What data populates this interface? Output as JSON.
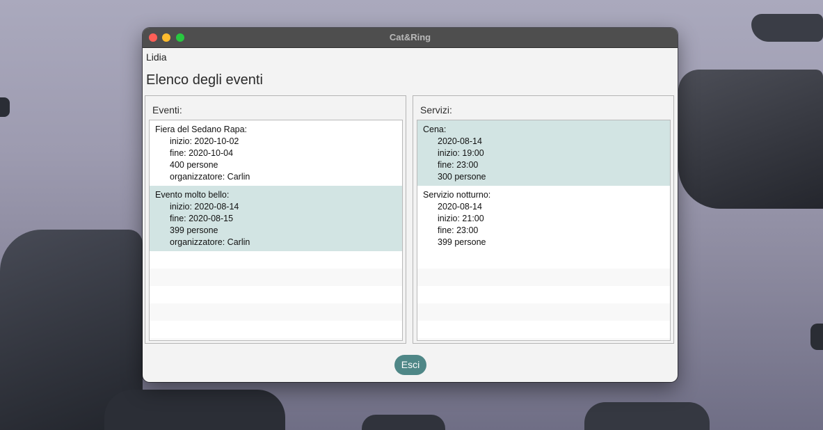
{
  "window": {
    "title": "Cat&Ring"
  },
  "header": {
    "user": "Lidia",
    "heading": "Elenco degli eventi"
  },
  "eventi": {
    "label": "Eventi:",
    "items": [
      {
        "name": "Fiera del Sedano Rapa:",
        "details": [
          "inizio: 2020-10-02",
          "fine: 2020-10-04",
          "400 persone",
          "organizzatore: Carlin"
        ],
        "selected": false
      },
      {
        "name": "Evento molto bello:",
        "details": [
          "inizio: 2020-08-14",
          "fine: 2020-08-15",
          "399 persone",
          "organizzatore: Carlin"
        ],
        "selected": true
      }
    ]
  },
  "servizi": {
    "label": "Servizi:",
    "items": [
      {
        "name": "Cena:",
        "details": [
          "2020-08-14",
          "inizio: 19:00",
          "fine: 23:00",
          "300 persone"
        ],
        "selected": true
      },
      {
        "name": "Servizio notturno:",
        "details": [
          "2020-08-14",
          "inizio: 21:00",
          "fine: 23:00",
          "399 persone"
        ],
        "selected": false
      }
    ]
  },
  "footer": {
    "exit_label": "Esci"
  },
  "colors": {
    "accent": "#4f8787",
    "selection": "#d2e4e3",
    "titlebar": "#4e4e4e"
  }
}
